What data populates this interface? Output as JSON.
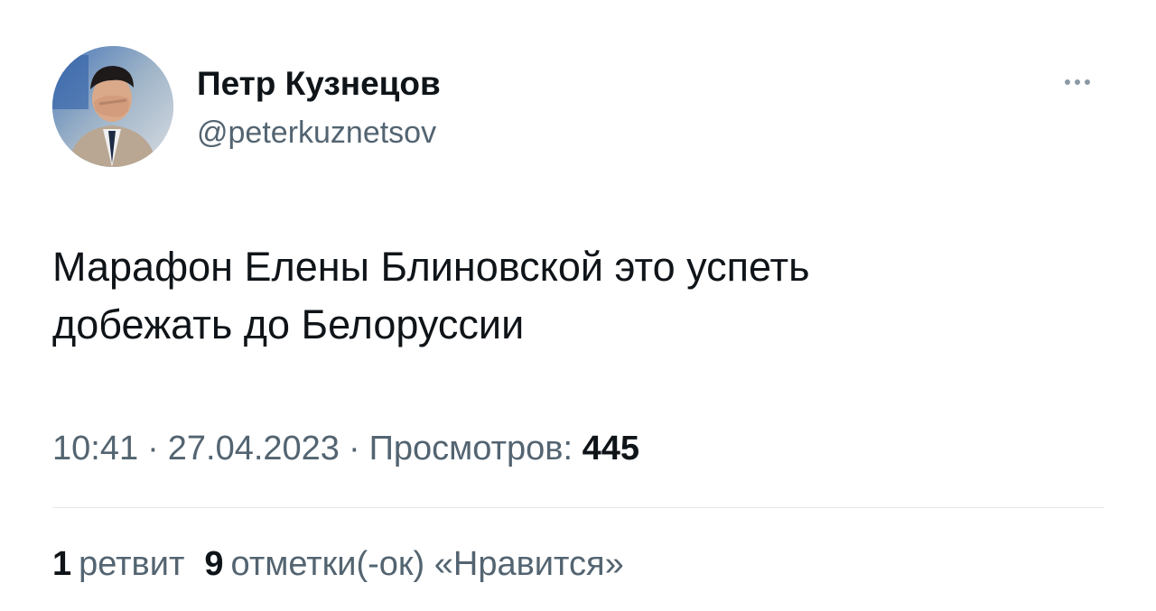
{
  "author": {
    "display_name": "Петр Кузнецов",
    "handle": "@peterkuznetsov"
  },
  "menu_icon": "more-horizontal-icon",
  "tweet": {
    "text_lines": [
      "Марафон Елены Блиновской это успеть",
      "добежать до Белоруссии"
    ]
  },
  "meta": {
    "time": "10:41",
    "separator": "·",
    "date": "27.04.2023",
    "views_label": "Просмотров:",
    "views_count": "445"
  },
  "stats": {
    "retweets_count": "1",
    "retweets_label": "ретвит",
    "likes_count": "9",
    "likes_label": "отметки(-ок) «Нравится»"
  },
  "colors": {
    "text_primary": "#0f1419",
    "text_secondary": "#536471",
    "divider": "#e4e8eb",
    "background": "#ffffff"
  }
}
